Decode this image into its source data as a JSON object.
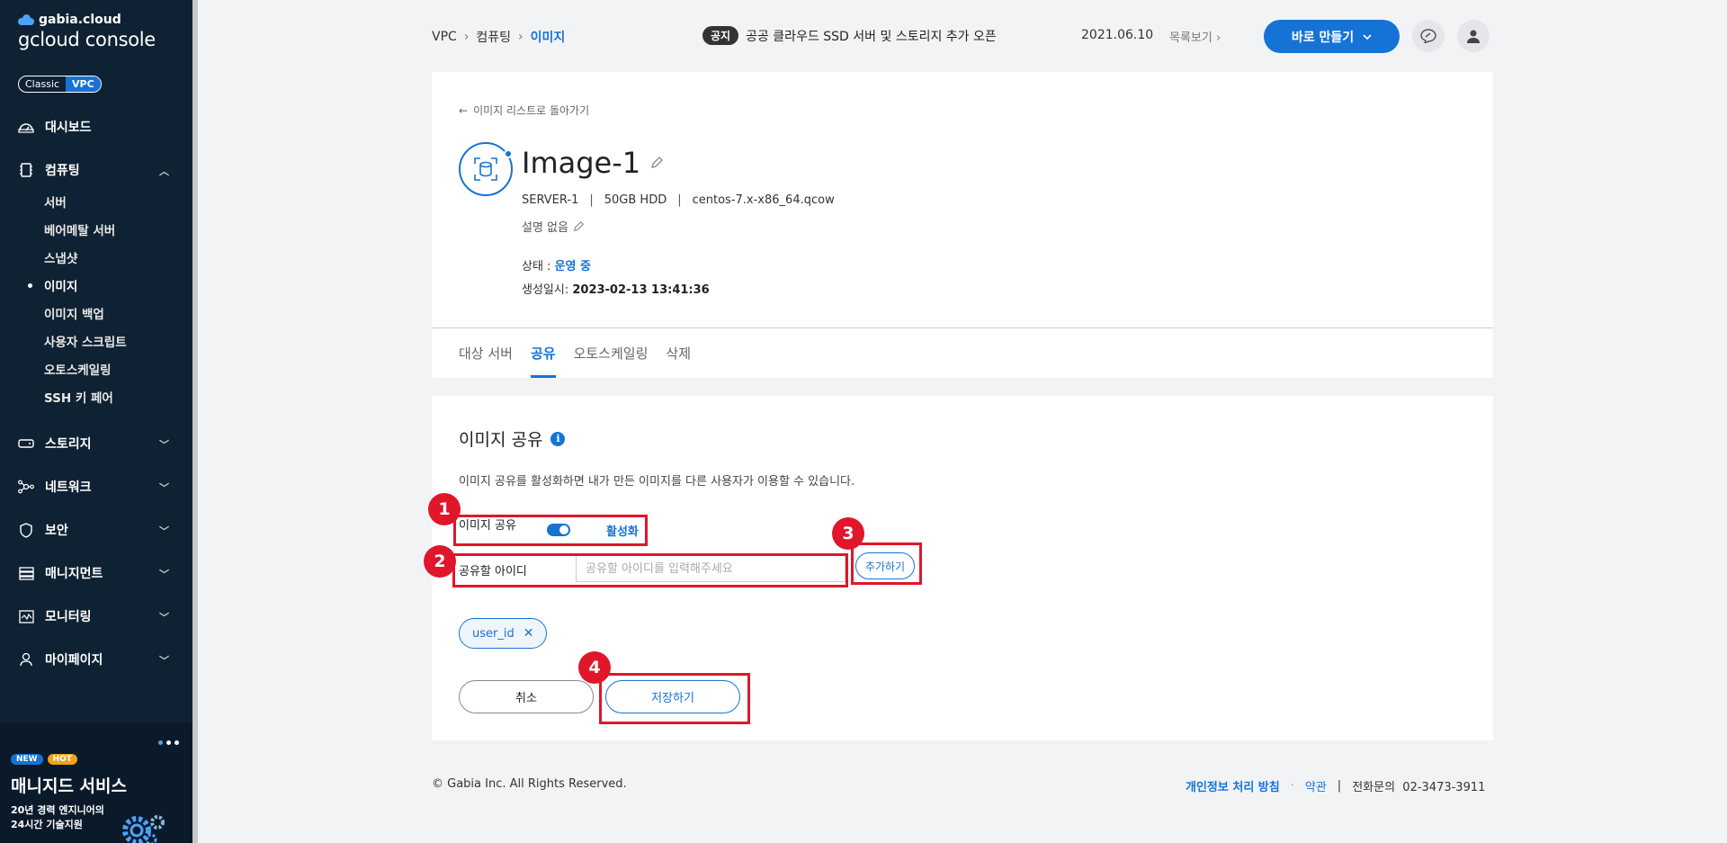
{
  "brand": {
    "top": "gabia.cloud",
    "main": "gcloud console"
  },
  "mode_toggle": {
    "classic": "Classic",
    "vpc": "VPC"
  },
  "sidebar": {
    "items": [
      {
        "label": "대시보드",
        "icon": "dashboard-icon"
      },
      {
        "label": "컴퓨팅",
        "icon": "chip-icon",
        "expanded": true
      },
      {
        "label": "스토리지",
        "icon": "storage-icon"
      },
      {
        "label": "네트워크",
        "icon": "network-icon"
      },
      {
        "label": "보안",
        "icon": "shield-icon"
      },
      {
        "label": "매니지먼트",
        "icon": "management-icon"
      },
      {
        "label": "모니터링",
        "icon": "monitoring-icon"
      },
      {
        "label": "마이페이지",
        "icon": "user-icon"
      }
    ],
    "computing_sub": [
      "서버",
      "베어메탈 서버",
      "스냅샷",
      "이미지",
      "이미지 백업",
      "사용자 스크립트",
      "오토스케일링",
      "SSH 키 페어"
    ]
  },
  "promo": {
    "badge_new": "NEW",
    "badge_hot": "HOT",
    "title": "매니지드 서비스",
    "line1": "20년 경력 엔지니어의",
    "line2": "24시간 기술지원"
  },
  "topbar": {
    "breadcrumb": [
      "VPC",
      "컴퓨팅",
      "이미지"
    ],
    "notice_tag": "공지",
    "notice_text": "공공 클라우드 SSD 서버 및 스토리지 추가 오픈",
    "notice_date": "2021.06.10",
    "notice_more": "목록보기",
    "make_button": "바로 만들기"
  },
  "detail": {
    "back": "이미지 리스트로 돌아가기",
    "name": "Image-1",
    "server": "SERVER-1",
    "disk": "50GB HDD",
    "os": "centos-7.x-x86_64.qcow",
    "desc": "설명 없음",
    "status_label": "상태 : ",
    "status_value": "운영 중",
    "created_label": "생성일시: ",
    "created_value": "2023-02-13 13:41:36",
    "tabs": [
      "대상 서버",
      "공유",
      "오토스케일링",
      "삭제"
    ]
  },
  "share": {
    "title": "이미지 공유",
    "desc": "이미지 공유를 활성화하면 내가 만든 이미지를 다른 사용자가 이용할 수 있습니다.",
    "toggle_label": "이미지 공유",
    "toggle_state": "활성화",
    "id_label": "공유할 아이디",
    "id_placeholder": "공유할 아이디를 입력해주세요",
    "add_button": "추가하기",
    "chip": "user_id",
    "cancel": "취소",
    "save": "저장하기"
  },
  "annotations": [
    "1",
    "2",
    "3",
    "4"
  ],
  "footer": {
    "copyright": "© Gabia Inc. All Rights Reserved.",
    "privacy": "개인정보 처리 방침",
    "terms": "약관",
    "phone_label": "전화문의",
    "phone": "02-3473-3911"
  },
  "colors": {
    "accent": "#1673d6",
    "sidebar_bg": "#0f2233",
    "annotation": "#e0162b"
  }
}
